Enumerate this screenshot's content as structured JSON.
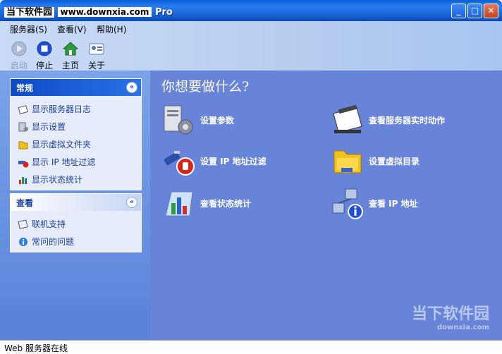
{
  "window": {
    "title_brand": "当下软件园",
    "title_watermark": "www.downxia.com",
    "title_suffix": "Pro",
    "btn_min": "_",
    "btn_max": "□",
    "btn_close": "✕"
  },
  "menu": [
    {
      "label": "服务器(S)"
    },
    {
      "label": "查看(V)"
    },
    {
      "label": "帮助(H)"
    }
  ],
  "toolbar": [
    {
      "label": "启动",
      "icon": "play-icon",
      "disabled": true
    },
    {
      "label": "停止",
      "icon": "stop-icon"
    },
    {
      "label": "主页",
      "icon": "home-icon"
    },
    {
      "label": "关于",
      "icon": "about-icon"
    }
  ],
  "groups": {
    "general": {
      "title": "常规",
      "collapse": "«",
      "items": [
        {
          "label": "显示服务器日志",
          "icon": "log-icon"
        },
        {
          "label": "显示设置",
          "icon": "settings-icon"
        },
        {
          "label": "显示虚拟文件夹",
          "icon": "folder-icon"
        },
        {
          "label": "显示 IP 地址过滤",
          "icon": "filter-icon"
        },
        {
          "label": "显示状态统计",
          "icon": "stats-icon"
        }
      ]
    },
    "view": {
      "title": "查看",
      "collapse": "«",
      "items": [
        {
          "label": "联机支持",
          "icon": "support-icon"
        },
        {
          "label": "常问的问题",
          "icon": "faq-icon"
        }
      ]
    }
  },
  "main": {
    "heading": "你想要做什么?",
    "tasks": [
      {
        "label": "设置参数",
        "icon": "server-settings-icon"
      },
      {
        "label": "查看服务器实时动作",
        "icon": "notepad-icon"
      },
      {
        "label": "设置 IP 地址过滤",
        "icon": "ip-filter-icon"
      },
      {
        "label": "设置虚拟目录",
        "icon": "virtual-folder-icon"
      },
      {
        "label": "查看状态统计",
        "icon": "chart-icon"
      },
      {
        "label": "查看 IP 地址",
        "icon": "network-info-icon"
      }
    ]
  },
  "watermark": {
    "text": "当下软件园",
    "sub": "downxia.com"
  },
  "status": {
    "text": "Web 服务器在线"
  }
}
